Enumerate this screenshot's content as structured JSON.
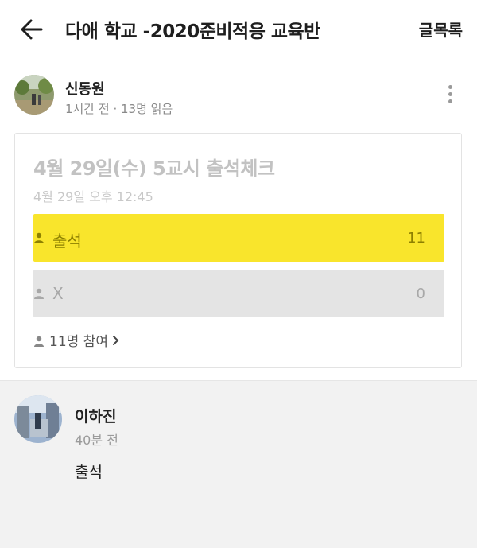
{
  "header": {
    "title": "다애 학교 -2020준비적응 교육반",
    "list_button": "글목록"
  },
  "post": {
    "author": "신동원",
    "meta": "1시간 전 · 13명 읽음"
  },
  "poll": {
    "title": "4월 29일(수) 5교시 출석체크",
    "date": "4월 29일 오후 12:45",
    "options": [
      {
        "label": "출석",
        "count": "11",
        "bg": "#f9e52c",
        "color": "#8d8000"
      },
      {
        "label": "X",
        "count": "0",
        "bg": "#e4e4e4",
        "color": "#a8a8a8"
      }
    ],
    "participants": "11명 참여"
  },
  "comment": {
    "author": "이하진",
    "time": "40분 전",
    "text": "출석"
  },
  "icons": {
    "back": "arrow-left-icon",
    "more": "more-vertical-icon",
    "person": "person-icon",
    "chevron": "chevron-right-icon"
  }
}
